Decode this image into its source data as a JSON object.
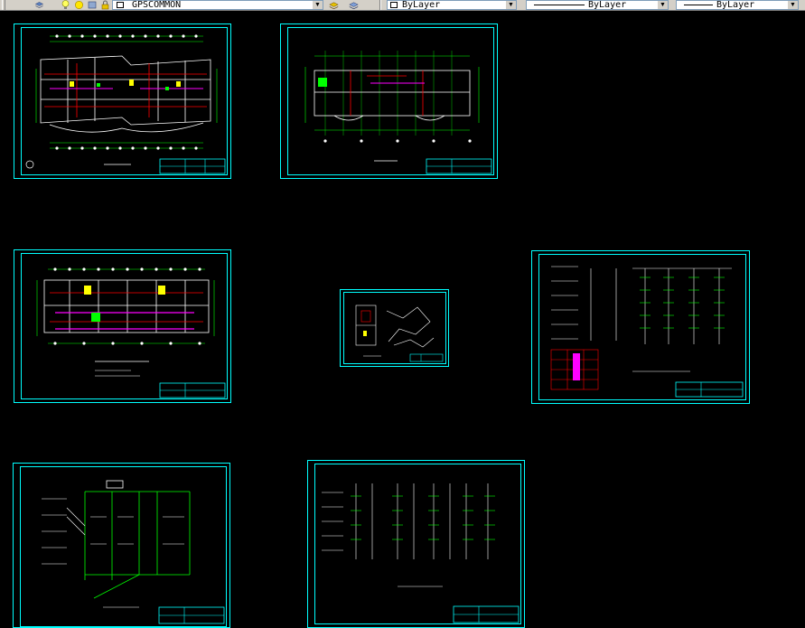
{
  "toolbar": {
    "layer_name": "GPSCOMMON",
    "color_value": "ByLayer",
    "linetype_value": "ByLayer",
    "lineweight_value": "ByLayer",
    "dropdown_arrow": "▼"
  },
  "sheets": [
    {
      "id": "sheet-1",
      "kind": "floor-plan"
    },
    {
      "id": "sheet-2",
      "kind": "floor-plan"
    },
    {
      "id": "sheet-3",
      "kind": "floor-plan"
    },
    {
      "id": "sheet-4",
      "kind": "detail-plan"
    },
    {
      "id": "sheet-5",
      "kind": "riser-diagram"
    },
    {
      "id": "sheet-6",
      "kind": "system-diagram"
    },
    {
      "id": "sheet-7",
      "kind": "riser-diagram"
    }
  ],
  "colors": {
    "background": "#000000",
    "sheet_border": "#00ffff",
    "line_white": "#ffffff",
    "line_green": "#00ff00",
    "line_red": "#ff0000",
    "line_magenta": "#ff00ff",
    "line_yellow": "#ffff00"
  },
  "icons": [
    "layer-manager-icon",
    "bulb-icon",
    "sun-icon",
    "lock-icon",
    "color-square-icon",
    "layer-state-icon",
    "layer-previous-icon"
  ]
}
